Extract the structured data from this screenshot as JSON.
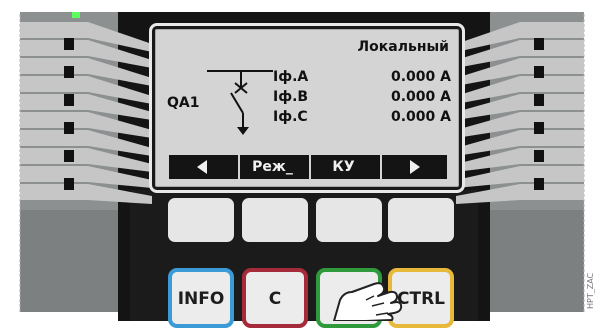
{
  "display": {
    "mode_label": "Локальный",
    "breaker_label": "QA1",
    "measurements": [
      {
        "label": "Iф.A",
        "value": "0.000 A"
      },
      {
        "label": "Iф.B",
        "value": "0.000 A"
      },
      {
        "label": "Iф.C",
        "value": "0.000 A"
      }
    ],
    "softkeys": [
      {
        "label": "",
        "icon": "arrow-left-icon"
      },
      {
        "label": "Реж_",
        "icon": ""
      },
      {
        "label": "КУ",
        "icon": ""
      },
      {
        "label": "",
        "icon": "arrow-right-icon"
      }
    ]
  },
  "hard_keys": [
    {
      "label": "INFO",
      "color": "#3a9bd6"
    },
    {
      "label": "C",
      "color": "#a52a3a"
    },
    {
      "label": "",
      "color": "#2e9a3c"
    },
    {
      "label": "CTRL",
      "color": "#e8b83a"
    }
  ],
  "image_tag": "HPT_ZAC",
  "colors": {
    "led": "#5cff5c"
  }
}
